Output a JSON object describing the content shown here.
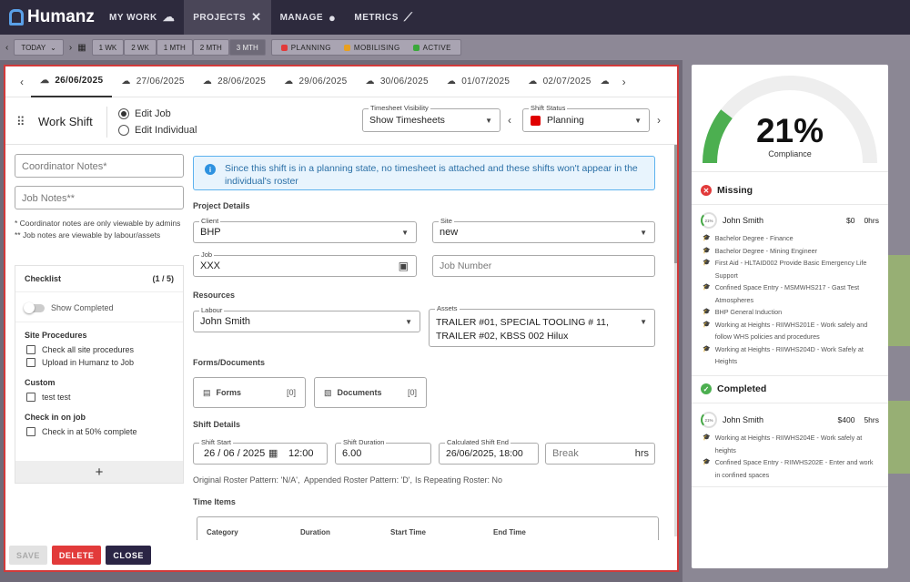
{
  "nav": {
    "brand": "Humanz",
    "items": [
      {
        "label": "MY WORK",
        "icon": "team-icon"
      },
      {
        "label": "PROJECTS",
        "icon": "tools-icon"
      },
      {
        "label": "MANAGE",
        "icon": "person-icon"
      },
      {
        "label": "METRICS",
        "icon": "chart-icon"
      }
    ],
    "active": "PROJECTS"
  },
  "toolbar": {
    "today_label": "TODAY",
    "ranges": [
      "1 WK",
      "2 WK",
      "1 MTH",
      "2 MTH",
      "3 MTH"
    ],
    "selected_range": "3 MTH",
    "legend": [
      {
        "label": "PLANNING",
        "color": "#e23a3a"
      },
      {
        "label": "MOBILISING",
        "color": "#e8a020"
      },
      {
        "label": "ACTIVE",
        "color": "#3aa83a"
      }
    ]
  },
  "dates": [
    "26/06/2025",
    "27/06/2025",
    "28/06/2025",
    "29/06/2025",
    "30/06/2025",
    "01/07/2025",
    "02/07/2025"
  ],
  "active_date": "26/06/2025",
  "header": {
    "title": "Work Shift",
    "edit_job": "Edit Job",
    "edit_individual": "Edit Individual",
    "timesheet_label": "Timesheet Visibility",
    "timesheet_value": "Show Timesheets",
    "status_label": "Shift Status",
    "status_value": "Planning",
    "status_color": "#e00000"
  },
  "left": {
    "coordinator_placeholder": "Coordinator Notes*",
    "job_notes_placeholder": "Job Notes**",
    "note1": "* Coordinator notes are only viewable by admins",
    "note2": "** Job notes are viewable by labour/assets"
  },
  "checklist": {
    "title": "Checklist",
    "count": "(1 / 5)",
    "show_completed": "Show Completed",
    "sections": [
      {
        "title": "Site Procedures",
        "items": [
          "Check all site procedures",
          "Upload in Humanz to Job"
        ]
      },
      {
        "title": "Custom",
        "items": [
          "test test"
        ]
      },
      {
        "title": "Check in on job",
        "items": [
          "Check in at 50% complete"
        ]
      }
    ],
    "add": "+"
  },
  "info": "Since this shift is in a planning state, no timesheet is attached and these shifts won't appear in the individual's roster",
  "project": {
    "section": "Project Details",
    "client_label": "Client",
    "client": "BHP",
    "site_label": "Site",
    "site": "new",
    "job_label": "Job",
    "job": "XXX",
    "job_number_placeholder": "Job Number"
  },
  "resources": {
    "section": "Resources",
    "labour_label": "Labour",
    "labour": "John Smith",
    "assets_label": "Assets",
    "assets": "TRAILER #01, SPECIAL TOOLING # 11, TRAILER #02, KBSS 002 Hilux"
  },
  "forms": {
    "section": "Forms/Documents",
    "forms_label": "Forms",
    "forms_count": "[0]",
    "documents_label": "Documents",
    "documents_count": "[0]"
  },
  "shift": {
    "section": "Shift Details",
    "start_label": "Shift Start",
    "start_date": "26 / 06 / 2025",
    "start_time": "12:00",
    "duration_label": "Shift Duration",
    "duration": "6.00",
    "end_label": "Calculated Shift End",
    "end": "26/06/2025, 18:00",
    "break_placeholder": "Break",
    "break_unit": "hrs",
    "roster_pattern": "Original Roster Pattern: 'N/A',",
    "appended_pattern": "Appended Roster Pattern: 'D',",
    "repeating": "Is Repeating Roster: No"
  },
  "time_items": {
    "section": "Time Items",
    "columns": [
      "Category",
      "Duration",
      "Start Time",
      "End Time"
    ]
  },
  "footer": {
    "save": "SAVE",
    "delete": "DELETE",
    "close": "CLOSE"
  },
  "compliance": {
    "percent_value": 21,
    "percent": "21%",
    "label": "Compliance",
    "missing_title": "Missing",
    "missing_person": {
      "ring": "21%",
      "name": "John Smith",
      "amount": "$0",
      "hours": "0hrs",
      "items": [
        "Bachelor Degree - Finance",
        "Bachelor Degree - Mining Engineer",
        "First Aid - HLTAID002 Provide Basic Emergency Life Support",
        "Confined Space Entry - MSMWHS217 - Gast Test Atmospheres",
        "BHP General Induction",
        "Working at Heights - RIIWHS201E - Work safely and follow WHS policies and procedures",
        "Working at Heights - RIIWHS204D - Work Safely at Heights"
      ]
    },
    "completed_title": "Completed",
    "completed_person": {
      "ring": "21%",
      "name": "John Smith",
      "amount": "$400",
      "hours": "5hrs",
      "items": [
        "Working at Heights - RIIWHS204E - Work safely at heights",
        "Confined Space Entry - RIIWHS202E - Enter and work in confined spaces"
      ]
    }
  }
}
